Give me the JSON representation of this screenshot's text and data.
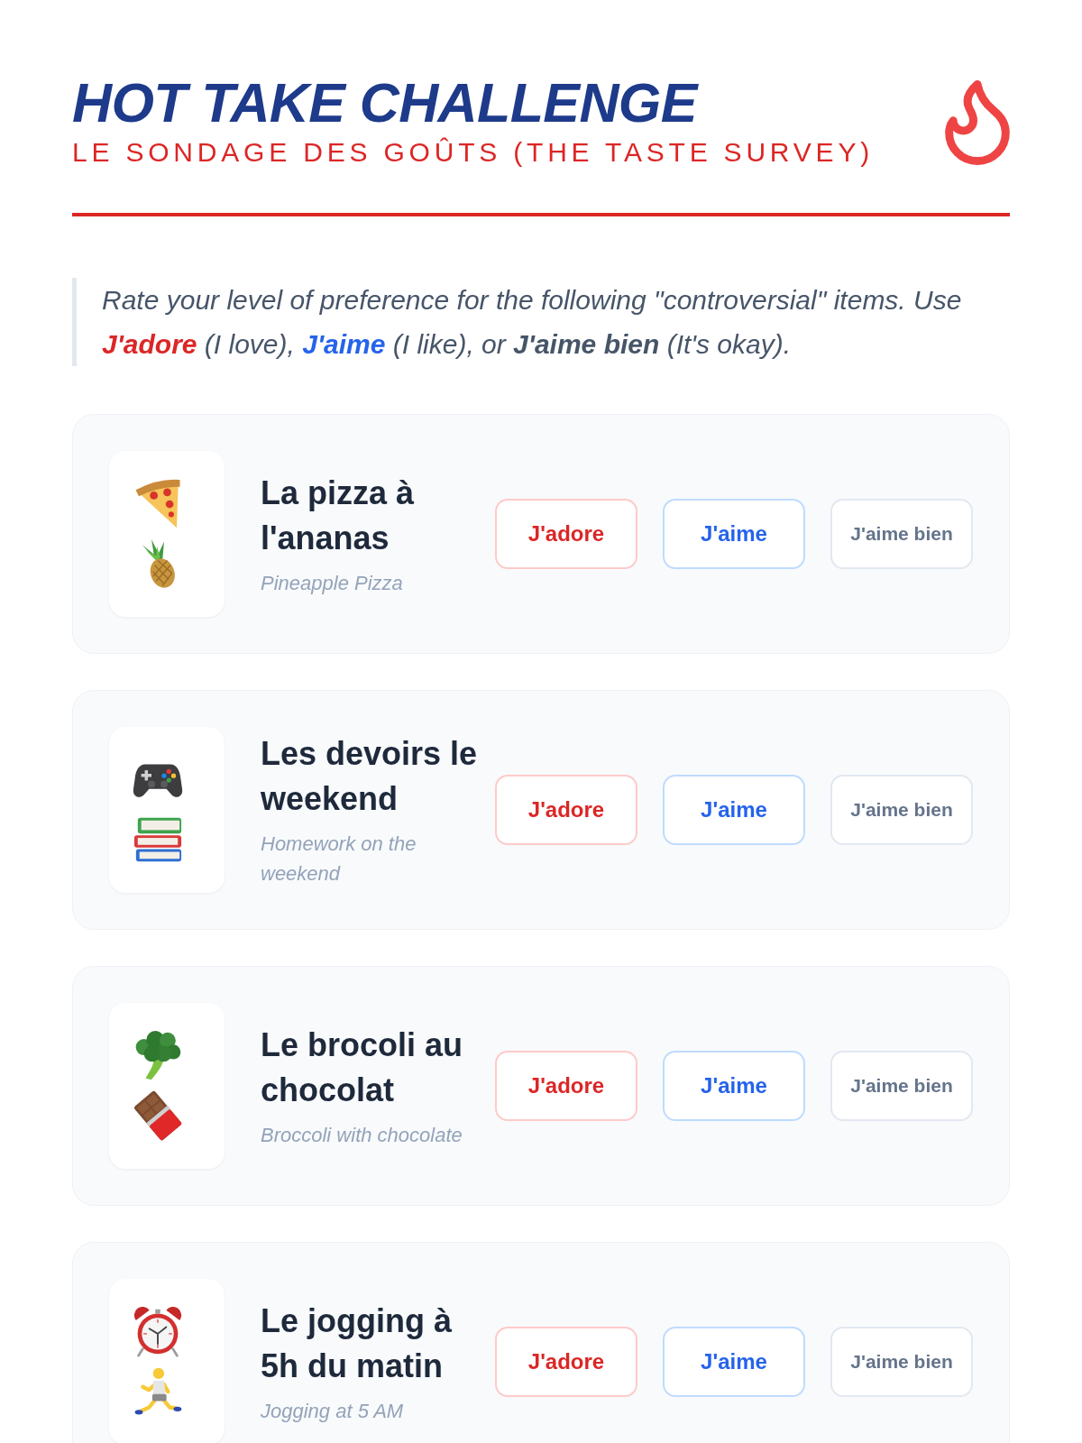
{
  "header": {
    "title": "HOT TAKE CHALLENGE",
    "subtitle": "LE SONDAGE DES GOÛTS (THE TASTE SURVEY)"
  },
  "intro": [
    {
      "kind": "plain",
      "text": "Rate your level of preference for the following \"controversial\" items. Use "
    },
    {
      "kind": "rating",
      "text": "J'adore",
      "color": "#dc2626"
    },
    {
      "kind": "plain",
      "text": " (I love), "
    },
    {
      "kind": "rating",
      "text": "J'aime",
      "color": "#2563eb"
    },
    {
      "kind": "plain",
      "text": " (I like), or "
    },
    {
      "kind": "rating",
      "text": "J'aime bien",
      "color": "#475569"
    },
    {
      "kind": "plain",
      "text": " (It's okay)."
    }
  ],
  "items": [
    {
      "title": "La pizza à l'ananas",
      "subtitle": "Pineapple Pizza",
      "options": [
        {
          "label": "J'adore",
          "kind": "love",
          "selected": false
        },
        {
          "label": "J'aime",
          "kind": "like",
          "selected": false
        },
        {
          "label": "J'aime bien",
          "kind": "okay",
          "selected": false
        }
      ]
    },
    {
      "title": "Les devoirs le weekend",
      "subtitle": "Homework on the weekend",
      "options": [
        {
          "label": "J'adore",
          "kind": "love",
          "selected": false
        },
        {
          "label": "J'aime",
          "kind": "like",
          "selected": false
        },
        {
          "label": "J'aime bien",
          "kind": "okay",
          "selected": false
        }
      ]
    },
    {
      "title": "Le brocoli au chocolat",
      "subtitle": "Broccoli with chocolate",
      "options": [
        {
          "label": "J'adore",
          "kind": "love",
          "selected": false
        },
        {
          "label": "J'aime",
          "kind": "like",
          "selected": false
        },
        {
          "label": "J'aime bien",
          "kind": "okay",
          "selected": false
        }
      ]
    },
    {
      "title": "Le jogging à 5h du matin",
      "subtitle": "Jogging at 5 AM",
      "options": [
        {
          "label": "J'adore",
          "kind": "love",
          "selected": false
        },
        {
          "label": "J'aime",
          "kind": "like",
          "selected": false
        },
        {
          "label": "J'aime bien",
          "kind": "okay",
          "selected": false
        }
      ]
    }
  ]
}
